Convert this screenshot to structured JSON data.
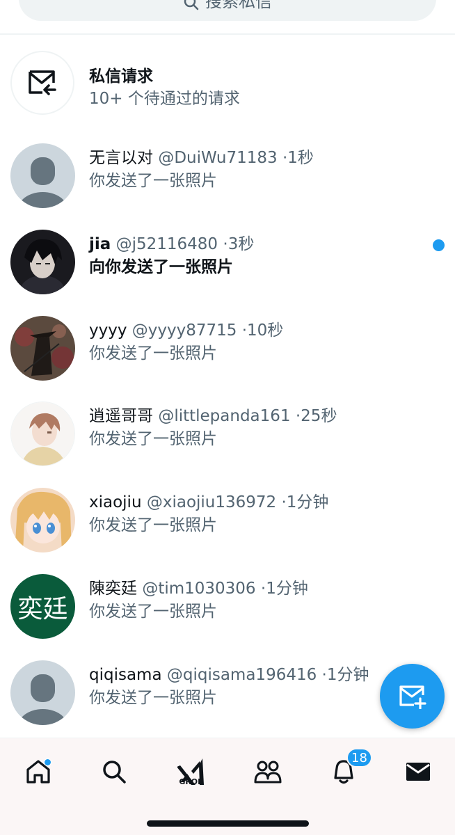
{
  "search": {
    "placeholder": "搜索私信"
  },
  "requests": {
    "title": "私信请求",
    "subtitle": "10+ 个待通过的请求"
  },
  "conversations": [
    {
      "name": "无言以对",
      "handle": "@DuiWu71183",
      "time": "1秒",
      "message": "你发送了一张照片",
      "unread": false,
      "avatar": "default-avatar"
    },
    {
      "name": "jia",
      "handle": "@j52116480",
      "time": "3秒",
      "message": "向你发送了一张照片",
      "unread": true,
      "avatar": "anime-boy-dark-avatar"
    },
    {
      "name": "yyyy",
      "handle": "@yyyy87715",
      "time": "10秒",
      "message": "你发送了一张照片",
      "unread": false,
      "avatar": "samurai-avatar"
    },
    {
      "name": "逍遥哥哥",
      "handle": "@littlepanda161",
      "time": "25秒",
      "message": "你发送了一张照片",
      "unread": false,
      "avatar": "anime-boy-light-avatar"
    },
    {
      "name": "xiaojiu",
      "handle": "@xiaojiu136972",
      "time": "1分钟",
      "message": "你发送了一张照片",
      "unread": false,
      "avatar": "anime-girl-avatar"
    },
    {
      "name": "陳奕廷",
      "handle": "@tim1030306",
      "time": "1分钟",
      "message": "你发送了一张照片",
      "unread": false,
      "avatar": "text-avatar",
      "avatar_text": "奕廷"
    },
    {
      "name": "qiqisama",
      "handle": "@qiqisama196416",
      "time": "1分钟",
      "message": "你发送了一张照片",
      "unread": false,
      "avatar": "default-avatar"
    }
  ],
  "separator": "·",
  "nav": {
    "items": [
      "home",
      "search",
      "grok",
      "communities",
      "notifications",
      "messages"
    ],
    "grok_label": "GROK",
    "notifications_badge": "18"
  },
  "colors": {
    "accent": "#1d9bf0",
    "secondary_text": "#536471",
    "primary_text": "#0f1419",
    "text_avatar_bg": "#0a5b3b"
  }
}
